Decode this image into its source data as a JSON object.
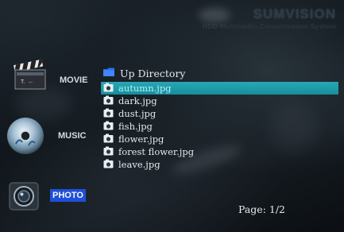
{
  "brand": {
    "name": "SUMVISION",
    "tagline": "HDD Multimedia Concentration System"
  },
  "sidebar": {
    "items": [
      {
        "label": "MOVIE",
        "icon": "clapperboard-icon",
        "active": false
      },
      {
        "label": "MUSIC",
        "icon": "cd-disc-icon",
        "active": false
      },
      {
        "label": "PHOTO",
        "icon": "camera-lens-icon",
        "active": true
      }
    ]
  },
  "file_browser": {
    "up_directory_label": "Up Directory",
    "files": [
      {
        "name": "autumn.jpg",
        "icon": "photo-file-icon",
        "selected": true
      },
      {
        "name": "dark.jpg",
        "icon": "photo-file-icon",
        "selected": false
      },
      {
        "name": "dust.jpg",
        "icon": "photo-file-icon",
        "selected": false
      },
      {
        "name": "fish.jpg",
        "icon": "photo-file-icon",
        "selected": false
      },
      {
        "name": "flower.jpg",
        "icon": "photo-file-icon",
        "selected": false
      },
      {
        "name": "forest flower.jpg",
        "icon": "photo-file-icon",
        "selected": false
      },
      {
        "name": "leave.jpg",
        "icon": "photo-file-icon",
        "selected": false
      }
    ],
    "page_label": "Page: 1/2"
  },
  "colors": {
    "selection": "#1e9aa8",
    "active_category": "#1f4fd8",
    "folder": "#2a6ff0"
  }
}
